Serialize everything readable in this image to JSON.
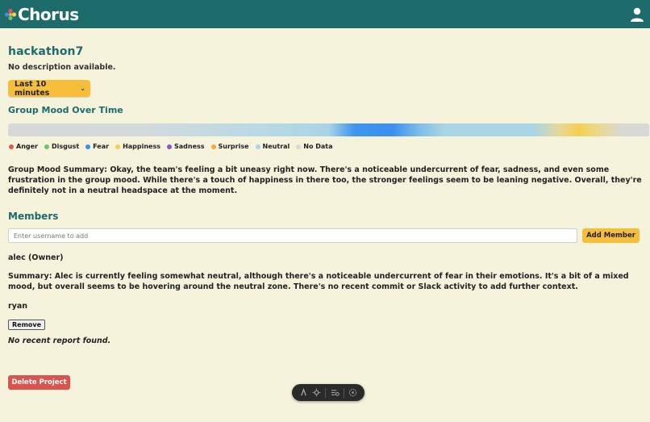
{
  "app": {
    "logo_text": "Chorus"
  },
  "project": {
    "title": "hackathon7",
    "description": "No description available."
  },
  "time_range": {
    "selected": "Last 10 minutes"
  },
  "mood_chart": {
    "heading": "Group Mood Over Time",
    "legend": [
      {
        "label": "Anger",
        "color": "#e05a4f"
      },
      {
        "label": "Disgust",
        "color": "#6ec26e"
      },
      {
        "label": "Fear",
        "color": "#3b8ff0"
      },
      {
        "label": "Happiness",
        "color": "#f4d050"
      },
      {
        "label": "Sadness",
        "color": "#8a55cc"
      },
      {
        "label": "Surprise",
        "color": "#f5a742"
      },
      {
        "label": "Neutral",
        "color": "#a9d5e6"
      },
      {
        "label": "No Data",
        "color": "#d8d8d8"
      }
    ]
  },
  "group_summary": {
    "label": "Group Mood Summary:",
    "text": "Okay, the team's feeling a bit uneasy right now. There's a noticeable undercurrent of fear, sadness, and even some frustration in the group mood. While there's a touch of happiness in there too, the stronger feelings seem to be leaning negative. Overall, they're definitely not in a neutral headspace at the moment."
  },
  "members": {
    "heading": "Members",
    "input_placeholder": "Enter username to add",
    "add_label": "Add Member",
    "list": [
      {
        "name": "alec (Owner)",
        "summary": "Summary: Alec is currently feeling somewhat neutral, although there's a noticeable undercurrent of fear in their emotions. It's a bit of a mixed mood, but overall seems to be hovering around the neutral zone. There's no recent commit or Slack activity to add further context."
      },
      {
        "name": "ryan",
        "remove_label": "Remove",
        "report": "No recent report found."
      }
    ]
  },
  "actions": {
    "delete_label": "Delete Project"
  },
  "toolbar": {
    "icons": [
      "pointer-icon",
      "settings-icon",
      "inspect-icon",
      "gear-icon"
    ]
  },
  "colors": {
    "brand": "#1e6b6b",
    "accent": "#f6be3a",
    "danger": "#d9534f",
    "background": "#f5f3dc"
  }
}
